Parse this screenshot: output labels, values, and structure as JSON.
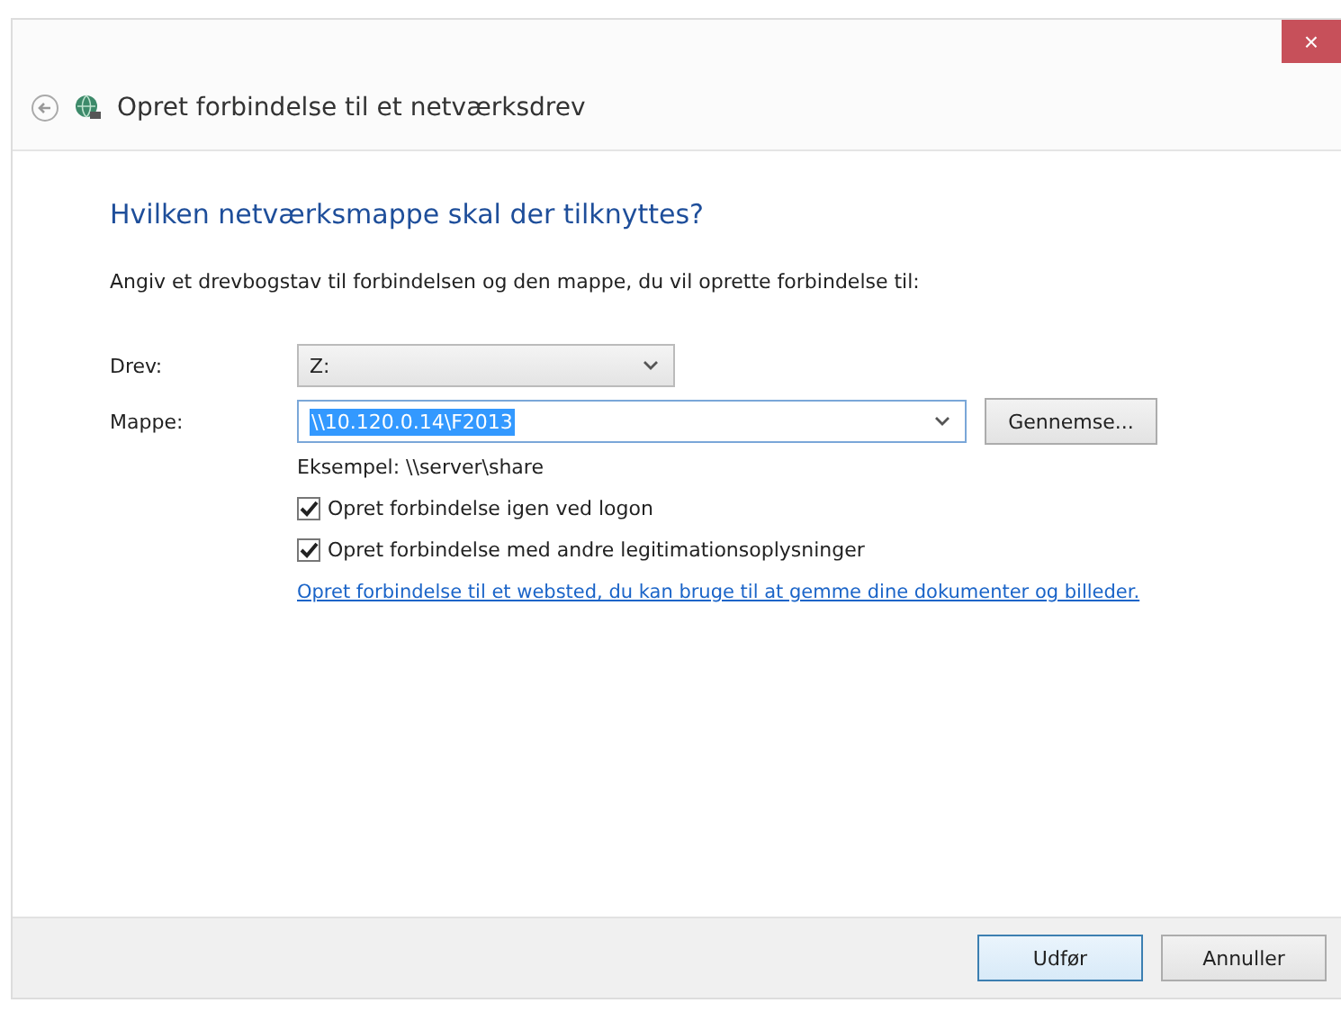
{
  "window": {
    "title": "Opret forbindelse til et netværksdrev",
    "close": "×"
  },
  "heading": "Hvilken netværksmappe skal der tilknyttes?",
  "instruction": "Angiv et drevbogstav til forbindelsen og den mappe, du vil oprette forbindelse til:",
  "drive": {
    "label": "Drev:",
    "value": "Z:"
  },
  "folder": {
    "label": "Mappe:",
    "value": "\\\\10.120.0.14\\F2013",
    "browse": "Gennemse..."
  },
  "example": "Eksempel: \\\\server\\share",
  "options": [
    {
      "label": "Opret forbindelse igen ved logon",
      "checked": true
    },
    {
      "label": "Opret forbindelse med andre legitimationsoplysninger",
      "checked": true
    }
  ],
  "link": "Opret forbindelse til et websted, du kan bruge til at gemme dine dokumenter og billeder.",
  "buttons": [
    {
      "label": "Udfør",
      "kind": "default"
    },
    {
      "label": "Annuller",
      "kind": "normal"
    }
  ]
}
